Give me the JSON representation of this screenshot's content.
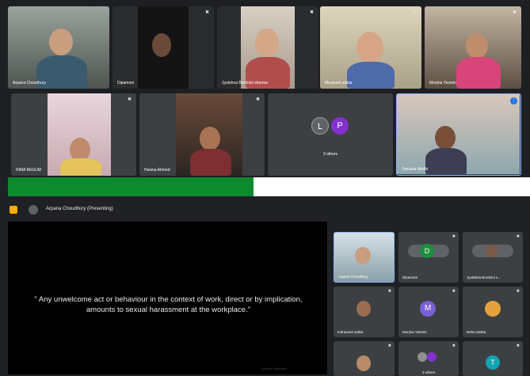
{
  "top_grid": {
    "row1": [
      {
        "name": "Arpana Choudhury"
      },
      {
        "name": "Dipamoni"
      },
      {
        "name": "Jyotshna Bordoloi sharma"
      },
      {
        "name": "Mousumi saikia"
      },
      {
        "name": "Morjina Yesmin"
      }
    ],
    "row2": [
      {
        "name": "RIMA BEGUM"
      },
      {
        "name": "Hasina Ahmed"
      },
      {
        "name": "3 others",
        "avatars": [
          "L",
          "P"
        ]
      },
      {
        "name": "Yamuna Medhi"
      }
    ]
  },
  "presenting": {
    "label": "Arpana Choudhury (Presenting)"
  },
  "slide": {
    "quote": "\" Any unwelcome act or behaviour in the context of work, direct or by implication, amounts to sexual harassment at the workplace.\"",
    "watermark": "Activate Windows"
  },
  "side_grid": [
    {
      "name": "Arpana Choudhury"
    },
    {
      "name": "Dipamoni",
      "avatar": "D"
    },
    {
      "name": "Jyotshna Bordoloi s..."
    },
    {
      "name": "Indrasonti saikia"
    },
    {
      "name": "Morjina Yasmin",
      "avatar": "M"
    },
    {
      "name": "Neha Saikia"
    },
    {
      "name": ""
    },
    {
      "name": "3 others"
    },
    {
      "name": "",
      "avatar": "T"
    }
  ],
  "colors": {
    "band_green": "#0c8a2e",
    "avatar_L": "#5f6368",
    "avatar_P": "#8430ce",
    "avatar_M": "#7b5fd9",
    "avatar_T": "#12a4af",
    "avatar_D": "#1e8e3e",
    "active_border": "#8ab4f8"
  }
}
